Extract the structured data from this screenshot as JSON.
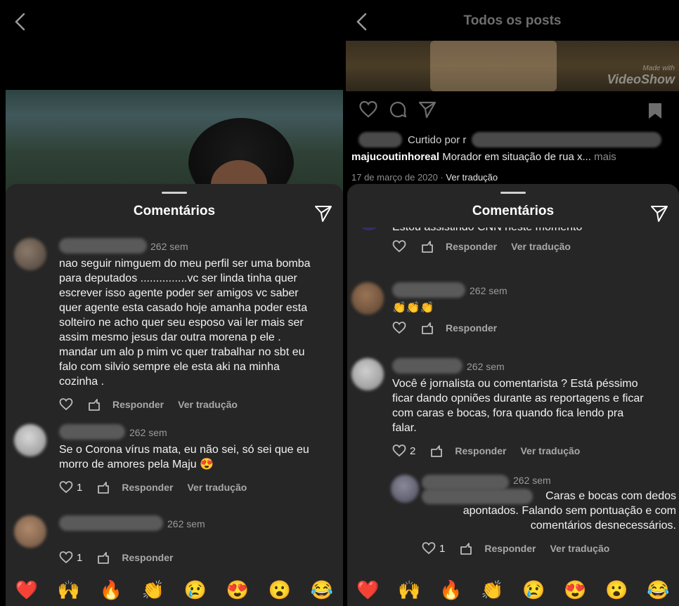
{
  "left": {
    "sheet_title": "Comentários",
    "comments": [
      {
        "time": "262 sem",
        "text": "nao seguir nimguem do meu perfil  ser uma bomba\npara deputados ...............vc ser linda  tinha quer\nescrever isso  agente poder ser amigos  vc saber\nquer agente esta casado hoje amanha poder esta\nsolteiro ne acho quer seu esposo vai ler  mais  ser\nassim mesmo jesus dar outra morena p ele .\nmandar um alo p mim vc quer trabalhar no sbt  eu\nfalo com silvio sempre ele esta aki na minha\ncozinha .",
        "like_count": "",
        "reply_label": "Responder",
        "translate_label": "Ver tradução"
      },
      {
        "time": "262 sem",
        "text": "Se o Corona vírus mata, eu não sei, só sei que eu\nmorro de amores pela Maju 😍",
        "like_count": "1",
        "reply_label": "Responder",
        "translate_label": "Ver tradução"
      },
      {
        "time": "262 sem",
        "text": "",
        "like_count": "1",
        "reply_label": "Responder",
        "translate_label": ""
      }
    ],
    "emojis": [
      "❤️",
      "🙌",
      "🔥",
      "👏",
      "😢",
      "😍",
      "😮",
      "😂"
    ]
  },
  "right": {
    "header_title": "Todos os posts",
    "watermark_line1": "Made with",
    "watermark_line2": "VideoShow",
    "liked_by": "Curtido por r",
    "caption_user": "majucoutinhoreal",
    "caption_text": " Morador em situação de rua x...",
    "caption_more": " mais",
    "post_date": "17 de março de 2020 · ",
    "post_translate": "Ver tradução",
    "sheet_title": "Comentários",
    "partial_comment": "Estou assistindo CNN neste momento",
    "partial_reply_label": "Responder",
    "partial_translate_label": "Ver tradução",
    "comments": [
      {
        "time": "262 sem",
        "text": "👏👏👏",
        "like_count": "",
        "reply_label": "Responder",
        "translate_label": ""
      },
      {
        "time": "262 sem",
        "text": "Você é jornalista ou comentarista ? Está péssimo\nficar dando opniões durante as reportagens e ficar\ncom caras e bocas, fora quando fica lendo pra\nfalar.",
        "like_count": "2",
        "reply_label": "Responder",
        "translate_label": "Ver tradução"
      },
      {
        "time": "262 sem",
        "text": "Caras e bocas com dedos\napontados. Falando sem pontuação e com\ncomentários desnecessários.",
        "like_count": "1",
        "reply_label": "Responder",
        "translate_label": "Ver tradução"
      }
    ],
    "emojis": [
      "❤️",
      "🙌",
      "🔥",
      "👏",
      "😢",
      "😍",
      "😮",
      "😂"
    ]
  },
  "colors": {
    "sheet_bg": "#262626",
    "muted": "#a8a8a8",
    "page_bg": "#000000"
  },
  "icons": [
    "back-chevron-icon",
    "send-icon",
    "heart-icon",
    "reply-icon",
    "comment-icon",
    "bookmark-icon"
  ]
}
